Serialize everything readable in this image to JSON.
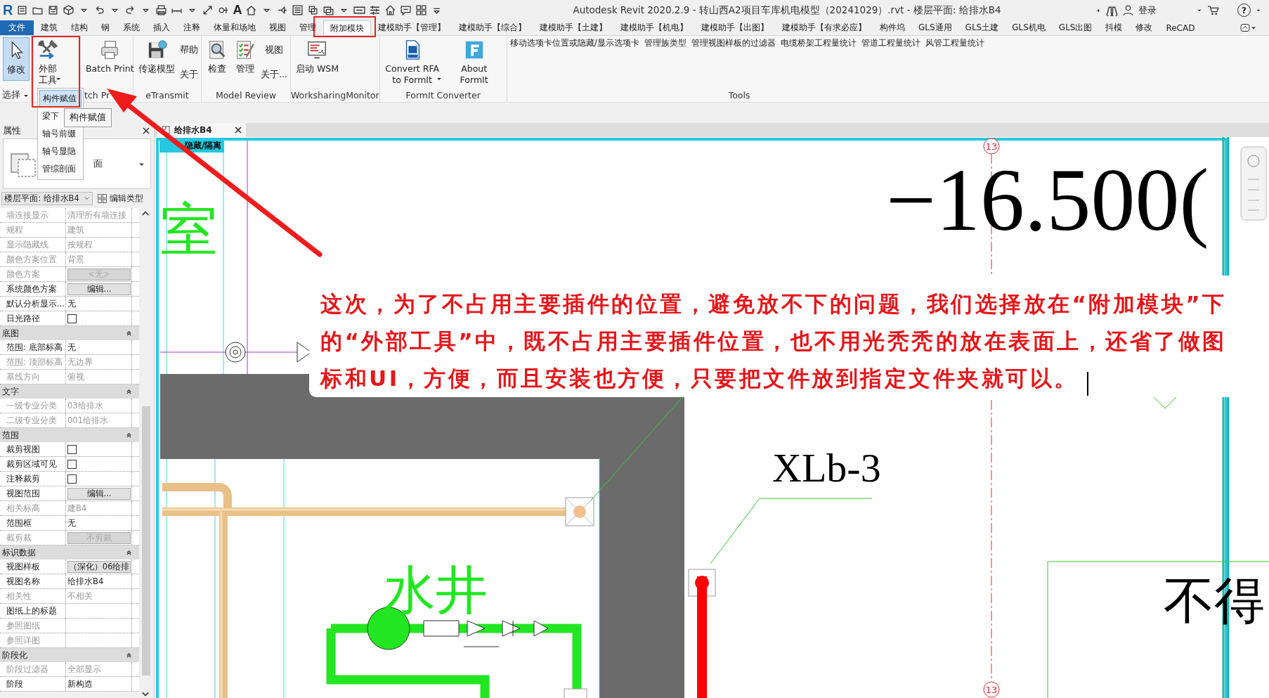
{
  "window": {
    "logo": "R",
    "text_tool": "A",
    "title": "Autodesk Revit 2020.2.9 - 转山西A2项目车库机电模型（20241029）.rvt - 楼层平面: 给排水B4",
    "sign_in": "登录",
    "help": "?"
  },
  "ribbon_tabs": [
    {
      "label": "文件",
      "kind": "file",
      "selected": false,
      "framed": false
    },
    {
      "label": "建筑",
      "kind": "tab",
      "selected": false,
      "framed": false
    },
    {
      "label": "结构",
      "kind": "tab",
      "selected": false,
      "framed": false
    },
    {
      "label": "钢",
      "kind": "tab",
      "selected": false,
      "framed": false
    },
    {
      "label": "系统",
      "kind": "tab",
      "selected": false,
      "framed": false
    },
    {
      "label": "插入",
      "kind": "tab",
      "selected": false,
      "framed": false
    },
    {
      "label": "注释",
      "kind": "tab",
      "selected": false,
      "framed": false
    },
    {
      "label": "体量和场地",
      "kind": "tab",
      "selected": false,
      "framed": false
    },
    {
      "label": "视图",
      "kind": "tab",
      "selected": false,
      "framed": false
    },
    {
      "label": "管理",
      "kind": "tab",
      "selected": false,
      "framed": false
    },
    {
      "label": "附加模块",
      "kind": "tab",
      "selected": true,
      "framed": true
    },
    {
      "label": "建模助手【管理】",
      "kind": "tab",
      "selected": false,
      "framed": false
    },
    {
      "label": "建模助手【综合】",
      "kind": "tab",
      "selected": false,
      "framed": false
    },
    {
      "label": "建模助手【土建】",
      "kind": "tab",
      "selected": false,
      "framed": false
    },
    {
      "label": "建模助手【机电】",
      "kind": "tab",
      "selected": false,
      "framed": false
    },
    {
      "label": "建模助手【出图】",
      "kind": "tab",
      "selected": false,
      "framed": false
    },
    {
      "label": "建模助手【有求必应】",
      "kind": "tab",
      "selected": false,
      "framed": false
    },
    {
      "label": "构件坞",
      "kind": "tab",
      "selected": false,
      "framed": false
    },
    {
      "label": "GLS通用",
      "kind": "tab",
      "selected": false,
      "framed": false
    },
    {
      "label": "GLS土建",
      "kind": "tab",
      "selected": false,
      "framed": false
    },
    {
      "label": "GLS机电",
      "kind": "tab",
      "selected": false,
      "framed": false
    },
    {
      "label": "GLS出图",
      "kind": "tab",
      "selected": false,
      "framed": false
    },
    {
      "label": "抖模",
      "kind": "tab",
      "selected": false,
      "framed": false
    },
    {
      "label": "修改",
      "kind": "tab",
      "selected": false,
      "framed": false
    },
    {
      "label": "ReCAD",
      "kind": "tab",
      "selected": false,
      "framed": false
    }
  ],
  "ribbon_panels": [
    {
      "label": "选择",
      "has_menu": true,
      "framed": false,
      "buttons": [
        {
          "kind": "large",
          "label": "修改",
          "active": true,
          "dropdown": false
        }
      ]
    },
    {
      "framed": true,
      "buttons": [
        {
          "kind": "large",
          "label": "外部工具",
          "active": false,
          "dropdown": true
        }
      ],
      "menu": {
        "items": [
          {
            "label": "构件赋值",
            "selected": true
          },
          {
            "label": "梁下",
            "selected": false
          },
          {
            "label": "轴号前缀",
            "selected": false
          },
          {
            "label": "轴号显隐",
            "selected": false
          },
          {
            "label": "管综剖面",
            "selected": false
          }
        ],
        "tooltip": "构件赋值"
      }
    },
    {
      "label": "tch Pr",
      "has_menu": false,
      "framed": false,
      "buttons": [
        {
          "kind": "large",
          "label": "Batch Print",
          "active": false,
          "dropdown": false
        }
      ]
    },
    {
      "label": "eTransmit",
      "has_menu": false,
      "framed": false,
      "buttons": [
        {
          "kind": "large",
          "label": "传递模型",
          "active": false,
          "dropdown": false
        },
        {
          "kind": "stack",
          "items": [
            "帮助",
            "关于"
          ]
        }
      ]
    },
    {
      "label": "Model Review",
      "has_menu": false,
      "framed": false,
      "buttons": [
        {
          "kind": "large",
          "label": "检查",
          "active": false,
          "dropdown": false
        },
        {
          "kind": "large",
          "label": "管理",
          "active": false,
          "dropdown": false
        },
        {
          "kind": "stack",
          "items": [
            "视图",
            "关于..."
          ]
        }
      ]
    },
    {
      "label": "WorksharingMonitor",
      "has_menu": false,
      "framed": false,
      "buttons": [
        {
          "kind": "large",
          "label": "启动 WSM",
          "active": false,
          "dropdown": false
        }
      ]
    },
    {
      "label": "FormIt Converter",
      "has_menu": false,
      "framed": false,
      "buttons": [
        {
          "kind": "large",
          "label": "Convert RFA to FormIt",
          "active": false,
          "dropdown": true
        },
        {
          "kind": "large",
          "label": "About FormIt",
          "active": false,
          "dropdown": false
        }
      ]
    },
    {
      "label": "Tools",
      "has_menu": false,
      "framed": false,
      "buttons": [
        {
          "kind": "text",
          "label": "移动选项卡位置或隐藏/显示选项卡"
        },
        {
          "kind": "text",
          "label": "管理族类型"
        },
        {
          "kind": "text",
          "label": "管理视图样板的过滤器"
        },
        {
          "kind": "text",
          "label": "电缆桥架工程量统计"
        },
        {
          "kind": "text",
          "label": "管道工程量统计"
        },
        {
          "kind": "text",
          "label": "风管工程量统计"
        }
      ]
    }
  ],
  "properties": {
    "title": "属性",
    "type_name": "面",
    "view_selector": "楼层平面: 给排水B4",
    "edit_type": "编辑类型",
    "groups": [
      {
        "rows": [
          {
            "label": "墙连接显示",
            "value": "清理所有墙连接",
            "kind": "text",
            "disabled": true
          },
          {
            "label": "规程",
            "value": "建筑",
            "kind": "text",
            "disabled": true
          },
          {
            "label": "显示隐藏线",
            "value": "按规程",
            "kind": "text",
            "disabled": true
          },
          {
            "label": "颜色方案位置",
            "value": "背景",
            "kind": "text",
            "disabled": true
          },
          {
            "label": "颜色方案",
            "value": "<无>",
            "kind": "button",
            "disabled": true
          },
          {
            "label": "系统颜色方案",
            "value": "编辑...",
            "kind": "button",
            "disabled": false
          },
          {
            "label": "默认分析显示...",
            "value": "无",
            "kind": "text",
            "disabled": false
          },
          {
            "label": "日光路径",
            "kind": "checkbox",
            "checked": false,
            "disabled": false
          }
        ]
      },
      {
        "title": "底图",
        "expanded": true,
        "rows": [
          {
            "label": "范围: 底部标高",
            "value": "无",
            "kind": "text",
            "disabled": false
          },
          {
            "label": "范围: 顶部标高",
            "value": "无边界",
            "kind": "text",
            "disabled": true
          },
          {
            "label": "基线方向",
            "value": "俯视",
            "kind": "text",
            "disabled": true
          }
        ]
      },
      {
        "title": "文字",
        "expanded": true,
        "rows": [
          {
            "label": "一级专业分类",
            "value": "03给排水",
            "kind": "text",
            "disabled": true
          },
          {
            "label": "二级专业分类",
            "value": "001给排水",
            "kind": "text",
            "disabled": true
          }
        ]
      },
      {
        "title": "范围",
        "expanded": true,
        "rows": [
          {
            "label": "裁剪视图",
            "kind": "checkbox",
            "checked": false,
            "disabled": false
          },
          {
            "label": "裁剪区域可见",
            "kind": "checkbox",
            "checked": false,
            "disabled": false
          },
          {
            "label": "注释裁剪",
            "kind": "checkbox",
            "checked": false,
            "disabled": false
          },
          {
            "label": "视图范围",
            "value": "编辑...",
            "kind": "button",
            "disabled": false
          },
          {
            "label": "相关标高",
            "value": "建B4",
            "kind": "text",
            "disabled": true
          },
          {
            "label": "范围框",
            "value": "无",
            "kind": "text",
            "disabled": false
          },
          {
            "label": "截剪裁",
            "value": "不剪裁",
            "kind": "button",
            "disabled": true
          }
        ]
      },
      {
        "title": "标识数据",
        "expanded": true,
        "rows": [
          {
            "label": "视图样板",
            "value": "（深化）06给排",
            "kind": "button",
            "disabled": false
          },
          {
            "label": "视图名称",
            "value": "给排水B4",
            "kind": "text",
            "disabled": false
          },
          {
            "label": "相关性",
            "value": "不相关",
            "kind": "text",
            "disabled": true
          },
          {
            "label": "图纸上的标题",
            "kind": "text",
            "disabled": false
          },
          {
            "label": "参照图纸",
            "kind": "text",
            "disabled": true
          },
          {
            "label": "参照详图",
            "kind": "text",
            "disabled": true
          }
        ]
      },
      {
        "title": "阶段化",
        "expanded": true,
        "rows": [
          {
            "label": "阶段过滤器",
            "value": "全部显示",
            "kind": "text",
            "disabled": true
          },
          {
            "label": "阶段",
            "value": "新构造",
            "kind": "text",
            "disabled": false
          }
        ]
      }
    ]
  },
  "view": {
    "tab": "给排水B4",
    "isolate_label": "隐藏/隔离",
    "texts": [
      {
        "kind": "room",
        "text": "室"
      },
      {
        "kind": "level",
        "text": "−16.500("
      },
      {
        "kind": "shaft",
        "text": "水井"
      },
      {
        "kind": "tag",
        "text": "XLb-3"
      },
      {
        "kind": "note",
        "text": "不得"
      },
      {
        "kind": "grid_top",
        "text": "13"
      },
      {
        "kind": "grid_bottom",
        "text": "13"
      }
    ]
  },
  "callout": {
    "text": "这次，为了不占用主要插件的位置，避免放不下的问题，我们选择放在“附加模块”下的“外部工具”中，既不占用主要插件位置，也不用光秃秃的放在表面上，还省了做图标和UI，方便，而且安装也方便，只要把文件放到指定文件夹就可以。",
    "cursor": true
  }
}
